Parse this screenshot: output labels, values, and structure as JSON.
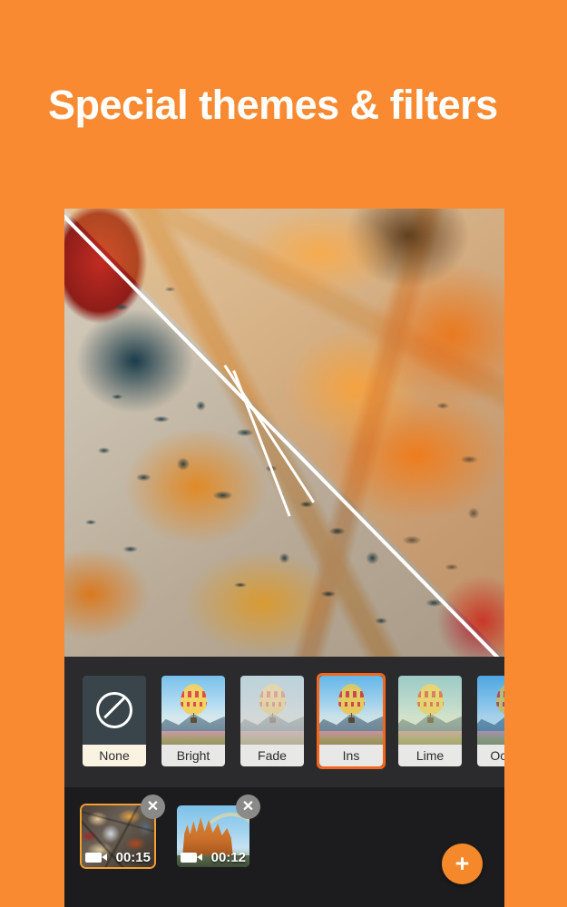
{
  "page": {
    "headline": "Special themes & filters",
    "background_color": "#f98a32",
    "accent_color": "#f4661b"
  },
  "preview": {
    "label": "split-screen filter preview of burgers and fries"
  },
  "filters": {
    "items": [
      {
        "label": "None",
        "icon": "no-filter-icon",
        "selected": false,
        "style": "none"
      },
      {
        "label": "Bright",
        "icon": "balloon-thumb",
        "selected": false,
        "style": "bright"
      },
      {
        "label": "Fade",
        "icon": "balloon-thumb",
        "selected": false,
        "style": "fade"
      },
      {
        "label": "Ins",
        "icon": "balloon-thumb",
        "selected": true,
        "style": "ins"
      },
      {
        "label": "Lime",
        "icon": "balloon-thumb",
        "selected": false,
        "style": "lime"
      },
      {
        "label": "Ocean",
        "icon": "balloon-thumb",
        "selected": false,
        "style": "ocean"
      }
    ]
  },
  "timeline": {
    "clips": [
      {
        "duration": "00:15",
        "selected": true,
        "close_label": "✕",
        "icon": "video-camera-icon",
        "thumb": "graffiti"
      },
      {
        "duration": "00:12",
        "selected": false,
        "close_label": "✕",
        "icon": "video-camera-icon",
        "thumb": "cathedral"
      }
    ],
    "add_label": "+"
  }
}
